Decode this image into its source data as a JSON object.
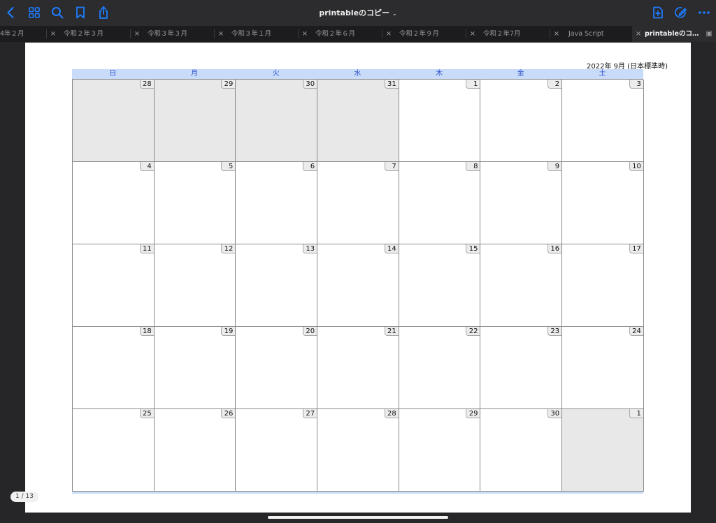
{
  "toolbar": {
    "title": "printableのコピー",
    "icons": [
      "chevron-left-icon",
      "grid-icon",
      "search-icon",
      "bookmark-icon",
      "share-icon",
      "new-doc-icon",
      "markup-icon",
      "more-icon"
    ],
    "accent_color": "#1e7cff"
  },
  "tabs": [
    {
      "label": "4年２月"
    },
    {
      "label": "令和２年３月"
    },
    {
      "label": "令和３年３月"
    },
    {
      "label": "令和３年１月"
    },
    {
      "label": "令和２年６月"
    },
    {
      "label": "令和２年９月"
    },
    {
      "label": "令和２年7月"
    },
    {
      "label": "Java Script"
    },
    {
      "label": "printableのコ…"
    }
  ],
  "calendar": {
    "title": "2022年 9月 (日本標準時)",
    "weekdays": [
      "日",
      "月",
      "火",
      "水",
      "木",
      "金",
      "土"
    ],
    "weeks": [
      [
        {
          "d": "28",
          "o": true
        },
        {
          "d": "29",
          "o": true
        },
        {
          "d": "30",
          "o": true
        },
        {
          "d": "31",
          "o": true
        },
        {
          "d": "1",
          "o": false
        },
        {
          "d": "2",
          "o": false
        },
        {
          "d": "3",
          "o": false
        }
      ],
      [
        {
          "d": "4",
          "o": false
        },
        {
          "d": "5",
          "o": false
        },
        {
          "d": "6",
          "o": false
        },
        {
          "d": "7",
          "o": false
        },
        {
          "d": "8",
          "o": false
        },
        {
          "d": "9",
          "o": false
        },
        {
          "d": "10",
          "o": false
        }
      ],
      [
        {
          "d": "11",
          "o": false
        },
        {
          "d": "12",
          "o": false
        },
        {
          "d": "13",
          "o": false
        },
        {
          "d": "14",
          "o": false
        },
        {
          "d": "15",
          "o": false
        },
        {
          "d": "16",
          "o": false
        },
        {
          "d": "17",
          "o": false
        }
      ],
      [
        {
          "d": "18",
          "o": false
        },
        {
          "d": "19",
          "o": false
        },
        {
          "d": "20",
          "o": false
        },
        {
          "d": "21",
          "o": false
        },
        {
          "d": "22",
          "o": false
        },
        {
          "d": "23",
          "o": false
        },
        {
          "d": "24",
          "o": false
        }
      ],
      [
        {
          "d": "25",
          "o": false
        },
        {
          "d": "26",
          "o": false
        },
        {
          "d": "27",
          "o": false
        },
        {
          "d": "28",
          "o": false
        },
        {
          "d": "29",
          "o": false
        },
        {
          "d": "30",
          "o": false
        },
        {
          "d": "1",
          "o": true
        }
      ]
    ]
  },
  "page_indicator": "1 / 13"
}
